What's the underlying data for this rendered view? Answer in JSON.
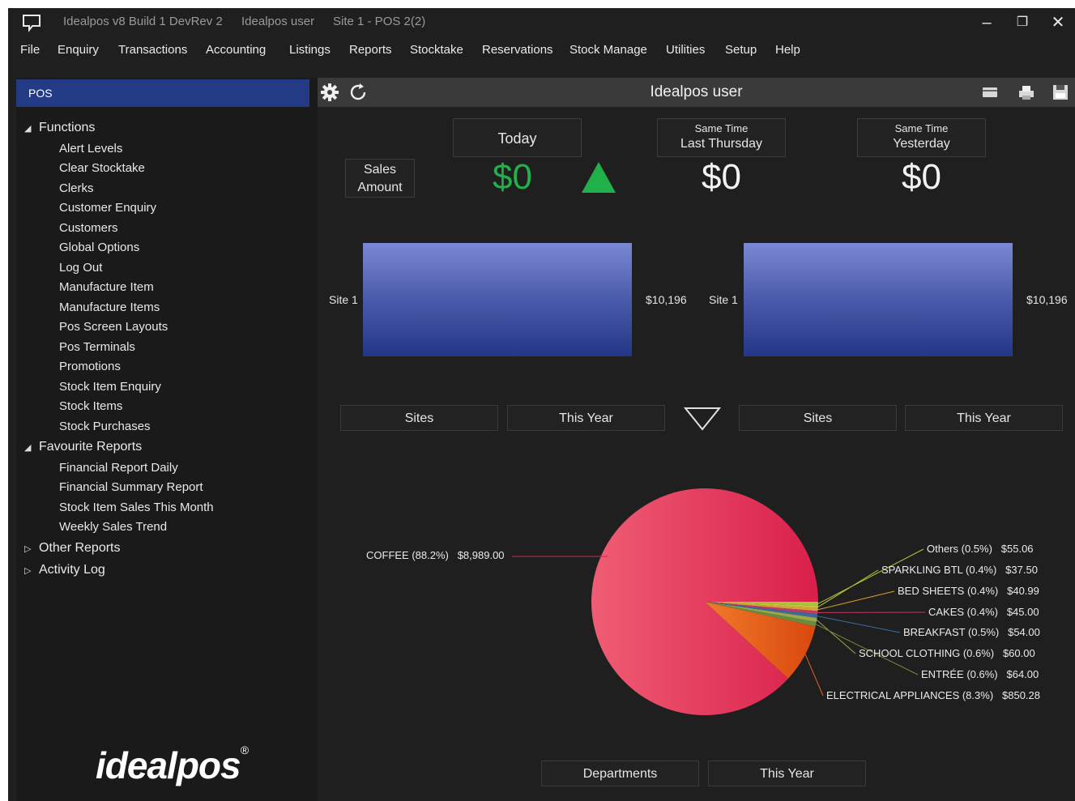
{
  "window": {
    "title_app": "Idealpos v8 Build 1 DevRev 2",
    "title_user": "Idealpos user",
    "title_site": "Site 1 - POS 2(2)",
    "minimize": "‒",
    "restore": "❐",
    "close": "✕"
  },
  "menu": [
    "File",
    "Enquiry",
    "Transactions",
    "Accounting",
    "Listings",
    "Reports",
    "Stocktake",
    "Reservations",
    "Stock Manage",
    "Utilities",
    "Setup",
    "Help"
  ],
  "sidebar": {
    "tab": "POS",
    "functions_label": "Functions",
    "functions": [
      "Alert Levels",
      "Clear Stocktake",
      "Clerks",
      "Customer Enquiry",
      "Customers",
      "Global Options",
      "Log Out",
      "Manufacture Item",
      "Manufacture Items",
      "Pos Screen Layouts",
      "Pos Terminals",
      "Promotions",
      "Stock Item Enquiry",
      "Stock Items",
      "Stock Purchases"
    ],
    "favourites_label": "Favourite Reports",
    "favourites": [
      "Financial Report Daily",
      "Financial Summary Report",
      "Stock Item Sales This Month",
      "Weekly Sales Trend"
    ],
    "other_reports": "Other Reports",
    "activity_log": "Activity Log",
    "logo": "idealpos",
    "logo_mark": "®"
  },
  "header": {
    "user": "Idealpos user",
    "icons": [
      "gear-icon",
      "refresh-icon",
      "card-icon",
      "printer-icon",
      "save-icon"
    ]
  },
  "kpi": {
    "sales_amount_line1": "Sales",
    "sales_amount_line2": "Amount",
    "today_label": "Today",
    "today_value": "$0",
    "last_thursday_line1": "Same Time",
    "last_thursday_line2": "Last Thursday",
    "last_thursday_value": "$0",
    "yesterday_line1": "Same Time",
    "yesterday_line2": "Yesterday",
    "yesterday_value": "$0",
    "trend": "up",
    "accent_green": "#22b04a"
  },
  "bar_charts": [
    {
      "category": "Site 1",
      "value_label": "$10,196",
      "selector1": "Sites",
      "selector2": "This Year"
    },
    {
      "category": "Site 1",
      "value_label": "$10,196",
      "selector1": "Sites",
      "selector2": "This Year"
    }
  ],
  "chart_data": {
    "type": "pie",
    "slices": [
      {
        "label": "COFFEE (88.2%)",
        "value_label": "$8,989.00",
        "value": 8989.0,
        "percent": 88.2,
        "color": "#e33a5c"
      },
      {
        "label": "ELECTRICAL APPLIANCES (8.3%)",
        "value_label": "$850.28",
        "value": 850.28,
        "percent": 8.3,
        "color": "#e8601c"
      },
      {
        "label": "ENTRÉE (0.6%)",
        "value_label": "$64.00",
        "value": 64.0,
        "percent": 0.6,
        "color": "#6a8a3c"
      },
      {
        "label": "SCHOOL CLOTHING (0.6%)",
        "value_label": "$60.00",
        "value": 60.0,
        "percent": 0.6,
        "color": "#9aa84a"
      },
      {
        "label": "BREAKFAST (0.5%)",
        "value_label": "$54.00",
        "value": 54.0,
        "percent": 0.5,
        "color": "#3e6a9a"
      },
      {
        "label": "CAKES (0.4%)",
        "value_label": "$45.00",
        "value": 45.0,
        "percent": 0.4,
        "color": "#c23a6a"
      },
      {
        "label": "BED SHEETS (0.4%)",
        "value_label": "$40.99",
        "value": 40.99,
        "percent": 0.4,
        "color": "#d9a23a"
      },
      {
        "label": "SPARKLING BTL (0.4%)",
        "value_label": "$37.50",
        "value": 37.5,
        "percent": 0.4,
        "color": "#c9c23a"
      },
      {
        "label": "Others (0.5%)",
        "value_label": "$55.06",
        "value": 55.06,
        "percent": 0.5,
        "color": "#a8c43a"
      }
    ]
  },
  "pie_selectors": {
    "left": "Departments",
    "right": "This Year"
  }
}
